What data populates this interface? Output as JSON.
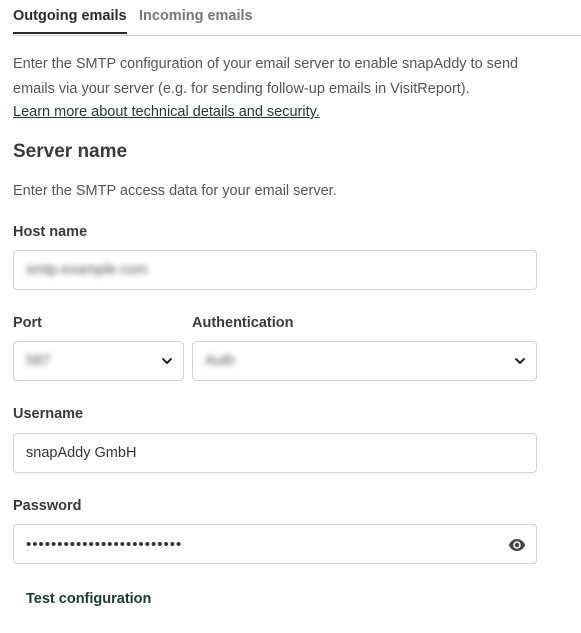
{
  "tabs": [
    {
      "label": "Outgoing emails",
      "active": true
    },
    {
      "label": "Incoming emails",
      "active": false
    }
  ],
  "intro_text": "Enter the SMTP configuration of your email server to enable snapAddy to send emails via your server (e.g. for sending follow-up emails in VisitReport).",
  "learn_more_link": "Learn more about technical details and security.",
  "section_title": "Server name",
  "section_subtitle": "Enter the SMTP access data for your email server.",
  "form": {
    "host_name": {
      "label": "Host name",
      "value": "smtp.example.com"
    },
    "port": {
      "label": "Port",
      "value": "587"
    },
    "authentication": {
      "label": "Authentication",
      "value": "Auth"
    },
    "username": {
      "label": "Username",
      "value": "snapAddy GmbH"
    },
    "password": {
      "label": "Password",
      "masked_value": "•••••••••••••••••••••••••"
    }
  },
  "test_button_label": "Test configuration",
  "colors": {
    "accent": "#163c33",
    "border": "#d3d3d3",
    "text": "#3f3f3f"
  }
}
